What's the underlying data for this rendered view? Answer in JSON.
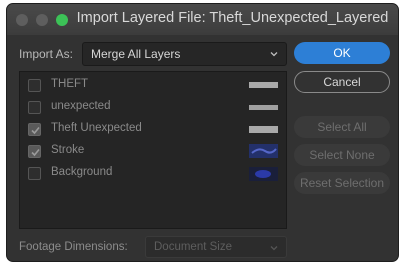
{
  "window": {
    "title": "Import Layered File: Theft_Unexpected_Layered"
  },
  "import_as": {
    "label": "Import As:",
    "selected": "Merge All Layers"
  },
  "layers": [
    {
      "name": "THEFT",
      "checked": false,
      "thumb": "gray-bar"
    },
    {
      "name": "unexpected",
      "checked": false,
      "thumb": "gray-bar"
    },
    {
      "name": "Theft Unexpected",
      "checked": true,
      "thumb": "gray-bar"
    },
    {
      "name": "Stroke",
      "checked": true,
      "thumb": "blue-stroke"
    },
    {
      "name": "Background",
      "checked": false,
      "thumb": "blue-blob"
    }
  ],
  "buttons": {
    "ok": "OK",
    "cancel": "Cancel",
    "select_all": "Select All",
    "select_none": "Select None",
    "reset_selection": "Reset Selection"
  },
  "footage": {
    "label": "Footage Dimensions:",
    "selected": "Document Size"
  },
  "colors": {
    "accent": "#2d7fd6",
    "traffic_green": "#3cc257",
    "window_bg": "#323232"
  }
}
